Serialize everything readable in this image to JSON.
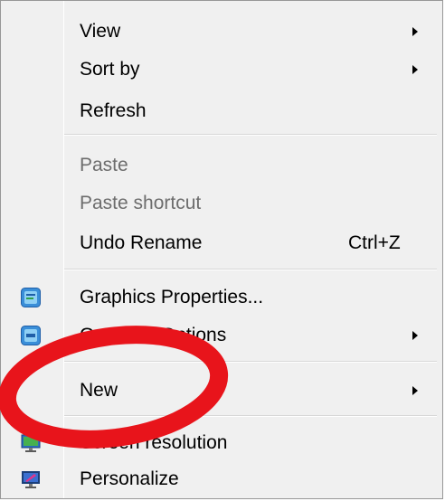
{
  "menu": {
    "items": [
      {
        "label": "View",
        "submenu": true
      },
      {
        "label": "Sort by",
        "submenu": true
      },
      {
        "label": "Refresh"
      },
      {
        "label": "Paste",
        "disabled": true
      },
      {
        "label": "Paste shortcut",
        "disabled": true
      },
      {
        "label": "Undo Rename",
        "shortcut": "Ctrl+Z"
      },
      {
        "label": "Graphics Properties...",
        "icon": "graphics-properties-icon"
      },
      {
        "label": "Graphics Options",
        "icon": "graphics-options-icon",
        "submenu": true
      },
      {
        "label": "New",
        "submenu": true
      },
      {
        "label": "Screen resolution",
        "icon": "screen-resolution-icon"
      },
      {
        "label": "Personalize",
        "icon": "personalize-icon"
      }
    ]
  },
  "annotation": {
    "color": "#e8141b",
    "shape": "ellipse"
  },
  "colors": {
    "menu_bg": "#f0f0f0",
    "disabled_text": "#6d6d6d",
    "border": "#979797"
  }
}
